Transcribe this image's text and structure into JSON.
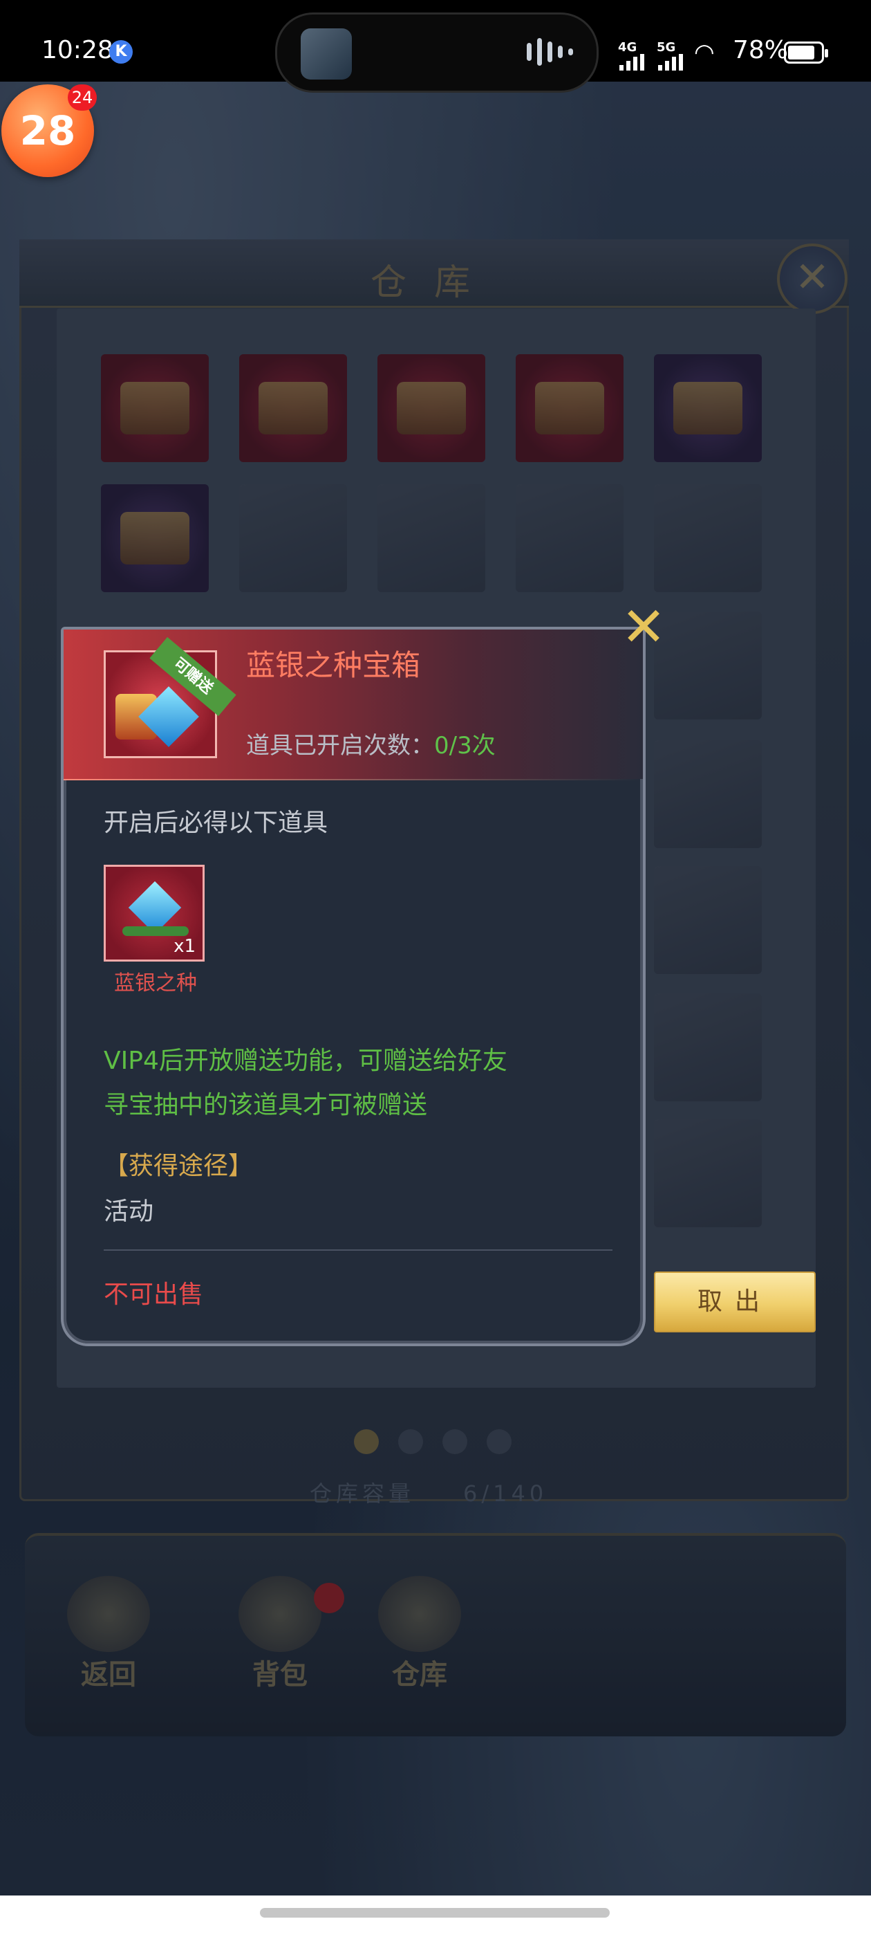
{
  "status_bar": {
    "time": "10:28",
    "k_badge": "K",
    "network_4g": "4G",
    "network_5g": "5G",
    "battery": "78%"
  },
  "floating_bubble": {
    "label": "28",
    "badge": "24"
  },
  "warehouse": {
    "title": "仓库",
    "close_label": "✕",
    "capacity_label": "仓库容量",
    "capacity_value": "6/140"
  },
  "bottom_bar": {
    "back": "返回",
    "bag": "背包",
    "warehouse": "仓库"
  },
  "dialog": {
    "item_name": "蓝银之种宝箱",
    "ribbon": "可赠送",
    "open_count_label": "道具已开启次数：",
    "open_count_value": "0/3次",
    "must_get": "开启后必得以下道具",
    "reward": {
      "name": "蓝银之种",
      "qty": "x1"
    },
    "note_line1": "VIP4后开放赠送功能，可赠送给好友",
    "note_line2": "寻宝抽中的该道具才可被赠送",
    "source_title": "【获得途径】",
    "source_value": "活动",
    "not_sellable": "不可出售",
    "take_out": "取出",
    "close_icon": "✕"
  },
  "colors": {
    "item_name": "#ff7d62",
    "green_text": "#5fbf45",
    "gold": "#d8a94d",
    "red_warning": "#e94b4b"
  }
}
